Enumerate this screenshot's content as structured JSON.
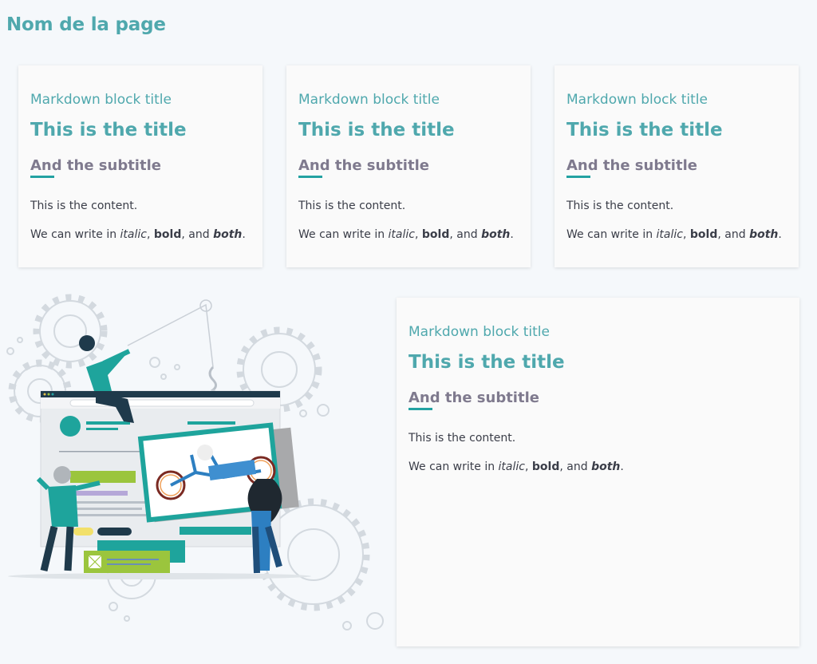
{
  "page": {
    "title": "Nom de la page"
  },
  "cards": [
    {
      "block_title": "Markdown block title",
      "title": "This is the title",
      "subtitle": "And the subtitle",
      "content": "This is the content.",
      "content2": {
        "prefix": "We can write in ",
        "italic": "italic",
        "sep1": ", ",
        "bold": "bold",
        "sep2": ", and ",
        "both": "both",
        "suffix": "."
      }
    },
    {
      "block_title": "Markdown block title",
      "title": "This is the title",
      "subtitle": "And the subtitle",
      "content": "This is the content.",
      "content2": {
        "prefix": "We can write in ",
        "italic": "italic",
        "sep1": ", ",
        "bold": "bold",
        "sep2": ", and ",
        "both": "both",
        "suffix": "."
      }
    },
    {
      "block_title": "Markdown block title",
      "title": "This is the title",
      "subtitle": "And the subtitle",
      "content": "This is the content.",
      "content2": {
        "prefix": "We can write in ",
        "italic": "italic",
        "sep1": ", ",
        "bold": "bold",
        "sep2": ", and ",
        "both": "both",
        "suffix": "."
      }
    },
    {
      "block_title": "Markdown block title",
      "title": "This is the title",
      "subtitle": "And the subtitle",
      "content": "This is the content.",
      "content2": {
        "prefix": "We can write in ",
        "italic": "italic",
        "sep1": ", ",
        "bold": "bold",
        "sep2": ", and ",
        "both": "both",
        "suffix": "."
      }
    }
  ],
  "colors": {
    "accent": "#4fa8ad",
    "subtitle": "#7f7a8e",
    "underline": "#23a2a2",
    "background": "#f5f8fb",
    "card": "#fafafa"
  },
  "illustration": {
    "icon": "team-building-website-illustration"
  }
}
